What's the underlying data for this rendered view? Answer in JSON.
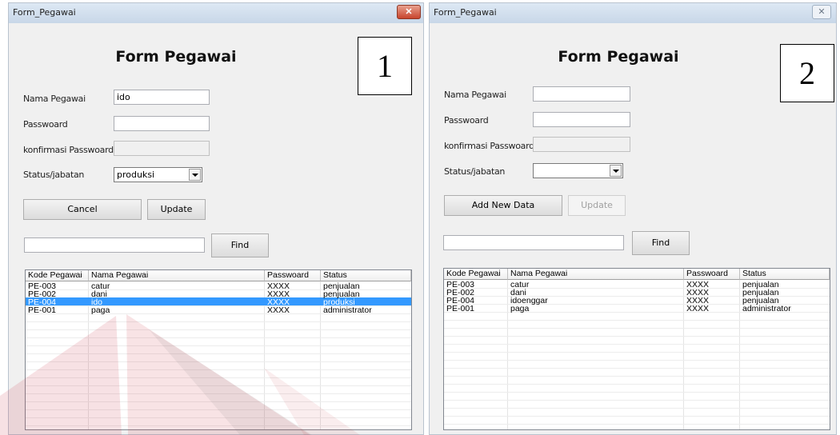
{
  "accent_colors": {
    "selection": "#3399ff",
    "close_active": "#c8452c",
    "watermark": "#c41a2c"
  },
  "window1": {
    "title": "Form_Pegawai",
    "close_label": "✕",
    "heading": "Form Pegawai",
    "panel_number": "1",
    "labels": {
      "nama": "Nama Pegawai",
      "password": "Passwoard",
      "konfirmasi": "konfirmasi Passwoard",
      "status": "Status/jabatan"
    },
    "fields": {
      "nama": "ido",
      "password": "",
      "konfirmasi": "",
      "status": "produksi",
      "search": ""
    },
    "buttons": {
      "primary": "Cancel",
      "update": "Update",
      "find": "Find"
    },
    "table": {
      "columns": [
        "Kode Pegawai",
        "Nama Pegawai",
        "Passwoard",
        "Status"
      ],
      "rows": [
        [
          "PE-003",
          "catur",
          "XXXX",
          "penjualan"
        ],
        [
          "PE-002",
          "dani",
          "XXXX",
          "penjualan"
        ],
        [
          "PE-004",
          "ido",
          "XXXX",
          "produksi"
        ],
        [
          "PE-001",
          "paga",
          "XXXX",
          "administrator"
        ]
      ],
      "selected_row": 2
    }
  },
  "window2": {
    "title": "Form_Pegawai",
    "close_label": "✕",
    "heading": "Form Pegawai",
    "panel_number": "2",
    "labels": {
      "nama": "Nama Pegawai",
      "password": "Passwoard",
      "konfirmasi": "konfirmasi Passwoard",
      "status": "Status/jabatan"
    },
    "fields": {
      "nama": "",
      "password": "",
      "konfirmasi": "",
      "status": "",
      "search": ""
    },
    "buttons": {
      "primary": "Add New Data",
      "update": "Update",
      "find": "Find"
    },
    "table": {
      "columns": [
        "Kode Pegawai",
        "Nama Pegawai",
        "Passwoard",
        "Status"
      ],
      "rows": [
        [
          "PE-003",
          "catur",
          "XXXX",
          "penjualan"
        ],
        [
          "PE-002",
          "dani",
          "XXXX",
          "penjualan"
        ],
        [
          "PE-004",
          "idoenggar",
          "XXXX",
          "penjualan"
        ],
        [
          "PE-001",
          "paga",
          "XXXX",
          "administrator"
        ]
      ],
      "selected_row": -1
    }
  }
}
